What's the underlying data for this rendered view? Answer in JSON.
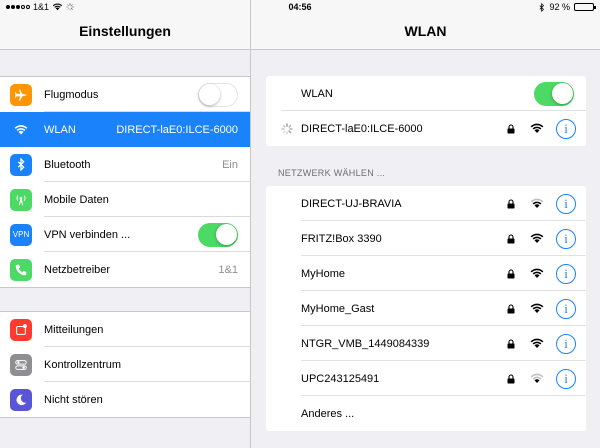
{
  "status_bar": {
    "carrier": "1&1",
    "time": "04:56",
    "battery": "92 %",
    "battery_level": 0.92
  },
  "master": {
    "title": "Einstellungen",
    "group1": [
      {
        "label": "Flugmodus",
        "icon": "airplane-icon",
        "color": "#ff9500",
        "toggle": "off"
      },
      {
        "label": "WLAN",
        "icon": "wifi-icon",
        "color": "#1a82fb",
        "value": "DIRECT-laE0:ILCE-6000",
        "selected": true
      },
      {
        "label": "Bluetooth",
        "icon": "bluetooth-icon",
        "color": "#1a82fb",
        "value": "Ein"
      },
      {
        "label": "Mobile Daten",
        "icon": "cellular-icon",
        "color": "#4cd964"
      },
      {
        "label": "VPN verbinden ...",
        "icon": "vpn-icon",
        "color": "#1a82fb",
        "toggle": "on",
        "icon_text": "VPN"
      },
      {
        "label": "Netzbetreiber",
        "icon": "phone-icon",
        "color": "#4cd964",
        "value": "1&1"
      }
    ],
    "group2": [
      {
        "label": "Mitteilungen",
        "icon": "notifications-icon",
        "color": "#ff3b30"
      },
      {
        "label": "Kontrollzentrum",
        "icon": "control-center-icon",
        "color": "#8e8e93"
      },
      {
        "label": "Nicht stören",
        "icon": "moon-icon",
        "color": "#5856d6"
      }
    ]
  },
  "detail": {
    "title": "WLAN",
    "wifi_toggle_label": "WLAN",
    "wifi_toggle": "on",
    "connected_network": "DIRECT-laE0:ILCE-6000",
    "section_label": "NETZWERK WÄHLEN ...",
    "networks": [
      {
        "name": "DIRECT-UJ-BRAVIA",
        "locked": true
      },
      {
        "name": "FRITZ!Box 3390",
        "locked": true
      },
      {
        "name": "MyHome",
        "locked": true
      },
      {
        "name": "MyHome_Gast",
        "locked": true
      },
      {
        "name": "NTGR_VMB_1449084339",
        "locked": true
      },
      {
        "name": "UPC243125491",
        "locked": true
      }
    ],
    "other_label": "Anderes ...",
    "info_glyph": "i"
  },
  "colors": {
    "accent": "#1a82fb",
    "toggle_on": "#4cd964",
    "background": "#efeff4"
  }
}
